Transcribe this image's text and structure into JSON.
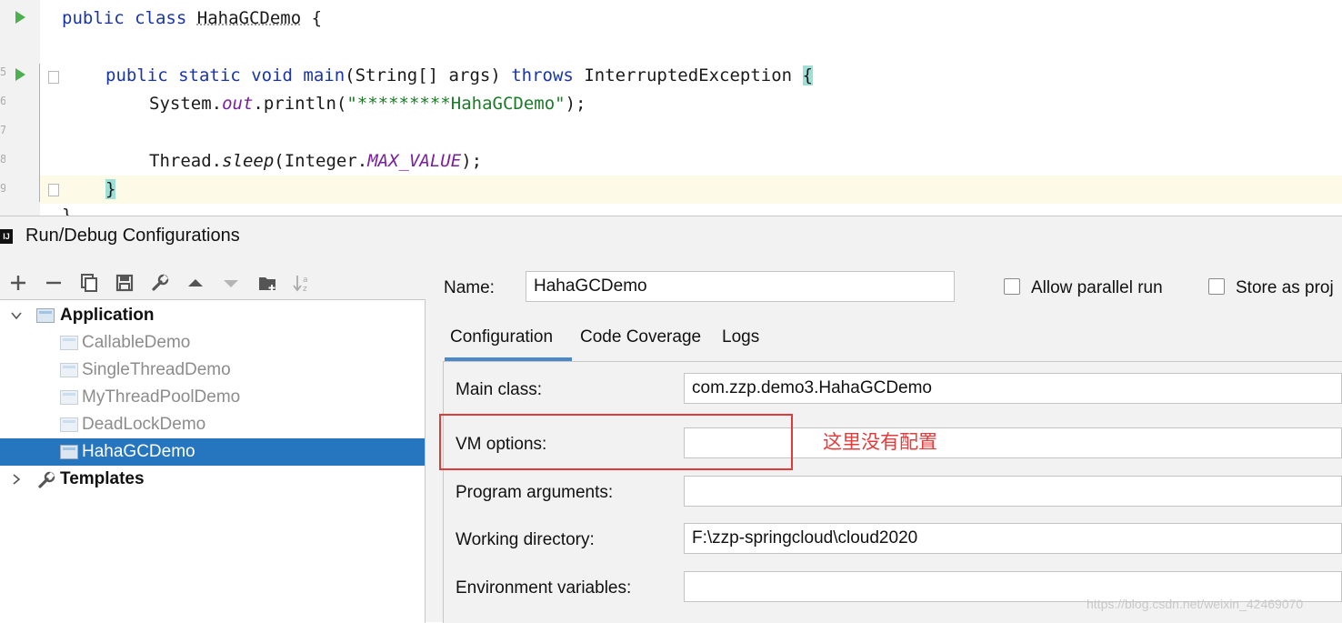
{
  "editor": {
    "line1": {
      "k1": "public",
      "k2": "class",
      "name": "HahaGCDemo",
      "brace": "{"
    },
    "line2": {
      "k1": "public",
      "k2": "static",
      "k3": "void",
      "method": "main",
      "params": "(String[] args)",
      "k4": "throws",
      "exc": "InterruptedException",
      "brace": "{"
    },
    "line3": {
      "pre": "System.",
      "field": "out",
      "call": ".println(",
      "str": "\"*********HahaGCDemo\"",
      "post": ");"
    },
    "line4": {
      "pre": "Thread.",
      "method": "sleep",
      "mid": "(Integer.",
      "const": "MAX_VALUE",
      "post": ");"
    },
    "line5": {
      "brace": "}"
    },
    "line6": {
      "brace": "}"
    },
    "line_numbers": [
      "",
      "5",
      "6",
      "7",
      "8",
      "9"
    ]
  },
  "dialog": {
    "title": "Run/Debug Configurations",
    "title_icon": "IJ",
    "toolbar": [
      "add-icon",
      "remove-icon",
      "copy-icon",
      "save-icon",
      "wrench-icon",
      "move-up-icon",
      "move-down-icon",
      "folder-icon",
      "sort-icon"
    ],
    "tree": {
      "application": "Application",
      "items": [
        "CallableDemo",
        "SingleThreadDemo",
        "MyThreadPoolDemo",
        "DeadLockDemo",
        "HahaGCDemo"
      ],
      "selected": "HahaGCDemo",
      "templates": "Templates"
    },
    "name_label": "Name:",
    "name_value": "HahaGCDemo",
    "allow_parallel": "Allow parallel run",
    "store_as": "Store as proj",
    "tabs": [
      "Configuration",
      "Code Coverage",
      "Logs"
    ],
    "active_tab": "Configuration",
    "fields": {
      "main_class_label": "Main class:",
      "main_class_value": "com.zzp.demo3.HahaGCDemo",
      "vm_options_label": "VM options:",
      "vm_options_value": "",
      "program_args_label": "Program arguments:",
      "program_args_value": "",
      "working_dir_label": "Working directory:",
      "working_dir_value": "F:\\zzp-springcloud\\cloud2020",
      "env_vars_label": "Environment variables:",
      "env_vars_value": ""
    },
    "annotation": "这里没有配置",
    "watermark": "https://blog.csdn.net/weixin_42469070"
  },
  "colors": {
    "keyword": "#1a35a8",
    "string": "#1d7b28",
    "italic_field": "#7a1fa0",
    "selection": "#2675bf",
    "annotation_red": "#e03b3b",
    "tab_underline": "#4a88c7"
  }
}
